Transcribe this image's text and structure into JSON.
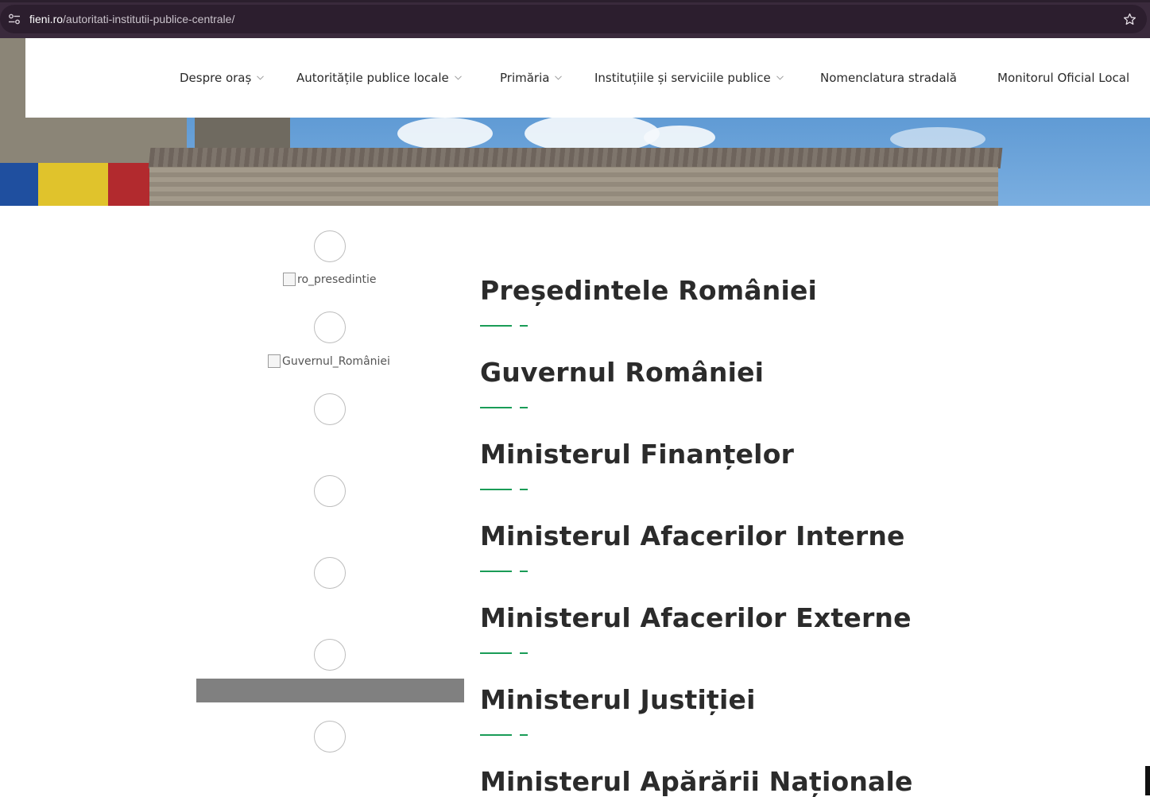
{
  "browser": {
    "url_host": "fieni.ro",
    "url_path": "/autoritati-institutii-publice-centrale/",
    "site_info_icon": "tune-icon",
    "bookmark_icon": "star-icon"
  },
  "nav": {
    "items": [
      {
        "label": "Despre oraș",
        "has_dropdown": true
      },
      {
        "label": "Autoritățile publice locale",
        "has_dropdown": true
      },
      {
        "label": "Primăria",
        "has_dropdown": true
      },
      {
        "label": "Instituțiile și serviciile publice",
        "has_dropdown": true
      },
      {
        "label": "Nomenclatura stradală",
        "has_dropdown": false
      },
      {
        "label": "Monitorul Oficial Local",
        "has_dropdown": false
      }
    ]
  },
  "logos": {
    "alt_presedintie": "ro_presedintie",
    "alt_guvern": "Guvernul_României"
  },
  "institutions": [
    "Președintele României",
    "Guvernul României",
    "Ministerul Finanțelor",
    "Ministerul Afacerilor Interne",
    "Ministerul Afacerilor Externe",
    "Ministerul Justiției",
    "Ministerul Apărării Naționale"
  ],
  "colors": {
    "accent": "#1a9c57",
    "chrome": "#3a2a3c",
    "title_text": "#2b2b2b"
  }
}
